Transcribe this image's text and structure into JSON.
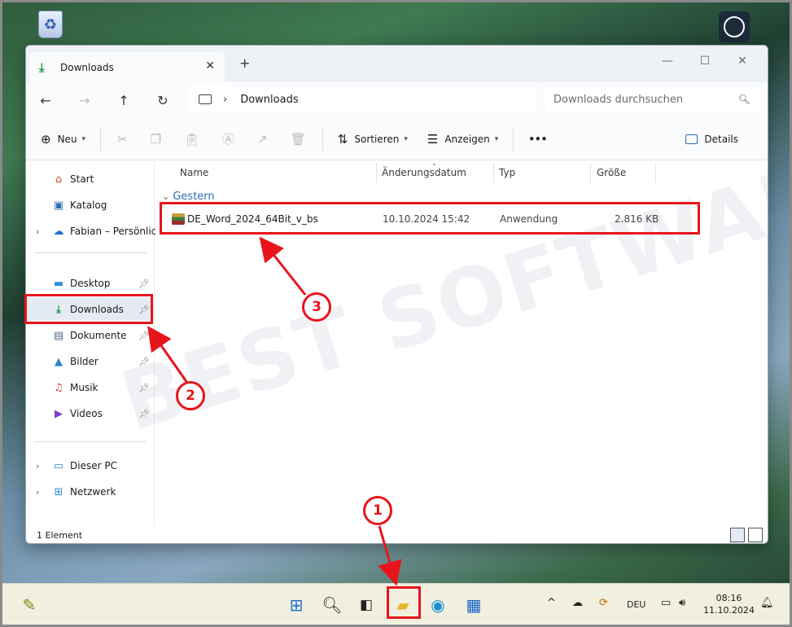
{
  "window": {
    "tab_title": "Downloads",
    "new_tab_label": "+",
    "controls": {
      "minimize": "—",
      "maximize": "☐",
      "close": "✕"
    }
  },
  "addressbar": {
    "back": "←",
    "forward": "→",
    "up": "↑",
    "refresh": "↻",
    "separator": "›",
    "location": "Downloads",
    "search_placeholder": "Downloads durchsuchen"
  },
  "toolbar": {
    "new_label": "Neu",
    "sort_label": "Sortieren",
    "view_label": "Anzeigen",
    "more_label": "•••",
    "details_label": "Details"
  },
  "sidebar": {
    "quick": [
      {
        "label": "Start",
        "icon": "home-icon"
      },
      {
        "label": "Katalog",
        "icon": "gallery-icon"
      },
      {
        "label": "Fabian – Persönlich",
        "icon": "onedrive-icon"
      }
    ],
    "pinned": [
      {
        "label": "Desktop",
        "icon": "desktop-icon"
      },
      {
        "label": "Downloads",
        "icon": "download-icon"
      },
      {
        "label": "Dokumente",
        "icon": "documents-icon"
      },
      {
        "label": "Bilder",
        "icon": "pictures-icon"
      },
      {
        "label": "Musik",
        "icon": "music-icon"
      },
      {
        "label": "Videos",
        "icon": "videos-icon"
      }
    ],
    "devices": [
      {
        "label": "Dieser PC",
        "icon": "pc-icon"
      },
      {
        "label": "Netzwerk",
        "icon": "network-icon"
      }
    ]
  },
  "columns": {
    "name": "Name",
    "date": "Änderungsdatum",
    "type": "Typ",
    "size": "Größe"
  },
  "group_label": "Gestern",
  "files": [
    {
      "name": "DE_Word_2024_64Bit_v_bs",
      "date": "10.10.2024 15:42",
      "type": "Anwendung",
      "size": "2.816 KB"
    }
  ],
  "status": {
    "count": "1 Element"
  },
  "watermark": "BEST SOFTWARE",
  "taskbar": {
    "tray_chevron": "^",
    "language": "DEU",
    "time": "08:16",
    "date": "11.10.2024"
  },
  "annotations": {
    "n1": "1",
    "n2": "2",
    "n3": "3"
  },
  "colors": {
    "accent": "#2b6cb5",
    "annotation": "#e8141c",
    "download_green": "#1a9a4a"
  }
}
